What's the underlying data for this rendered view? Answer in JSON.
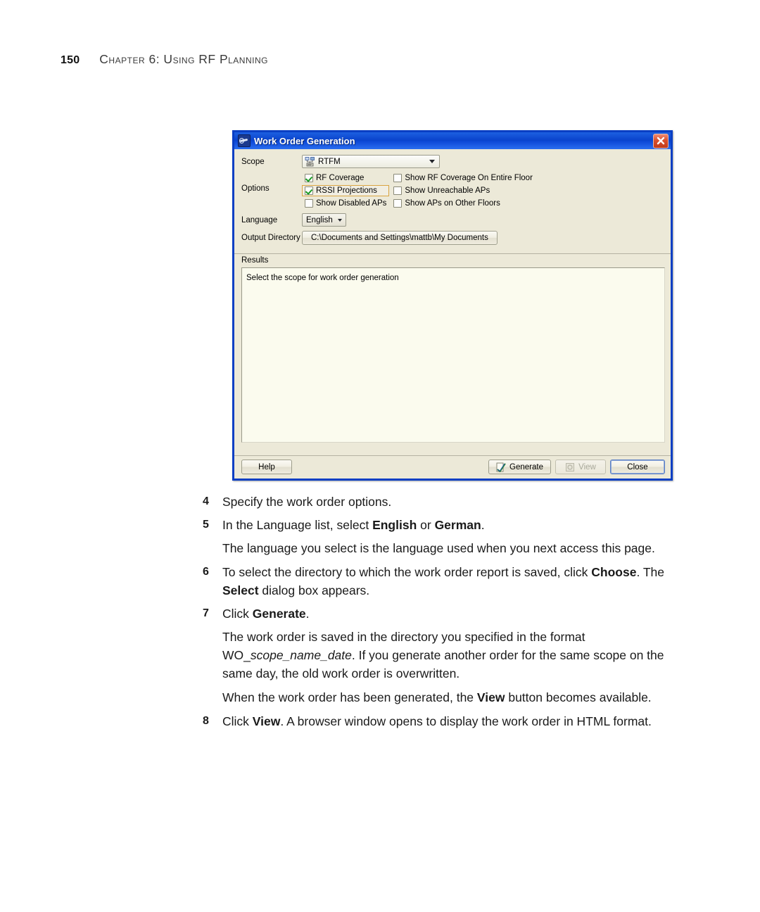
{
  "page": {
    "number": "150",
    "chapter": "Chapter 6: Using RF Planning"
  },
  "dialog": {
    "title": "Work Order Generation",
    "title_icon": "binoculars-icon",
    "close_icon": "close-icon",
    "scope": {
      "label": "Scope",
      "value": "RTFM",
      "icon": "network-campus-icon"
    },
    "options": {
      "label": "Options",
      "items": [
        {
          "label": "RF Coverage",
          "checked": true,
          "focused": false
        },
        {
          "label": "Show RF Coverage On Entire Floor",
          "checked": false,
          "focused": false
        },
        {
          "label": "RSSI Projections",
          "checked": true,
          "focused": true
        },
        {
          "label": "Show Unreachable APs",
          "checked": false,
          "focused": false
        },
        {
          "label": "Show Disabled APs",
          "checked": false,
          "focused": false
        },
        {
          "label": "Show APs on Other Floors",
          "checked": false,
          "focused": false
        }
      ]
    },
    "language": {
      "label": "Language",
      "value": "English"
    },
    "output_directory": {
      "label": "Output Directory",
      "value": "C:\\Documents and Settings\\mattb\\My Documents"
    },
    "results": {
      "label": "Results",
      "message": "Select the scope for work order generation"
    },
    "buttons": {
      "help": "Help",
      "generate": "Generate",
      "generate_icon": "check-document-icon",
      "view": "View",
      "view_icon": "preview-icon",
      "view_disabled": true,
      "close": "Close"
    },
    "colors": {
      "titlebar_blue": "#0a43cc",
      "window_face": "#ece9d8",
      "results_background": "#fbfbee",
      "focus_ring": "#d9a441",
      "check_green": "#1a9a22",
      "close_red": "#c03c1c"
    }
  },
  "steps": [
    {
      "number": "4",
      "parts": [
        {
          "t": "Specify the work order options.",
          "b": false
        }
      ]
    },
    {
      "number": "5",
      "parts": [
        {
          "t": "In the Language list, select ",
          "b": false
        },
        {
          "t": "English",
          "b": true
        },
        {
          "t": " or ",
          "b": false
        },
        {
          "t": "German",
          "b": true
        },
        {
          "t": ".",
          "b": false
        }
      ]
    }
  ],
  "paragraph_5": [
    {
      "t": "The language you select is the language used when you next access this page.",
      "b": false
    }
  ],
  "step_6": {
    "number": "6",
    "parts": [
      {
        "t": "To select the directory to which the work order report is saved, click ",
        "b": false
      },
      {
        "t": "Choose",
        "b": true
      },
      {
        "t": ". The ",
        "b": false
      },
      {
        "t": "Select",
        "b": true
      },
      {
        "t": " dialog box appears.",
        "b": false
      }
    ]
  },
  "step_7": {
    "number": "7",
    "parts": [
      {
        "t": "Click ",
        "b": false
      },
      {
        "t": "Generate",
        "b": true
      },
      {
        "t": ".",
        "b": false
      }
    ]
  },
  "paragraph_7a": [
    {
      "t": "The work order is saved in the directory you specified in the format WO_",
      "b": false
    },
    {
      "t": "scope_name_date",
      "i": true
    },
    {
      "t": ". If you generate another order for the same scope on the same day, the old work order is overwritten.",
      "b": false
    }
  ],
  "paragraph_7b": [
    {
      "t": "When the work order has been generated, the ",
      "b": false
    },
    {
      "t": "View",
      "b": true
    },
    {
      "t": " button becomes available.",
      "b": false
    }
  ],
  "step_8": {
    "number": "8",
    "parts": [
      {
        "t": "Click ",
        "b": false
      },
      {
        "t": "View",
        "b": true
      },
      {
        "t": ". A browser window opens to display the work order in HTML format.",
        "b": false
      }
    ]
  }
}
